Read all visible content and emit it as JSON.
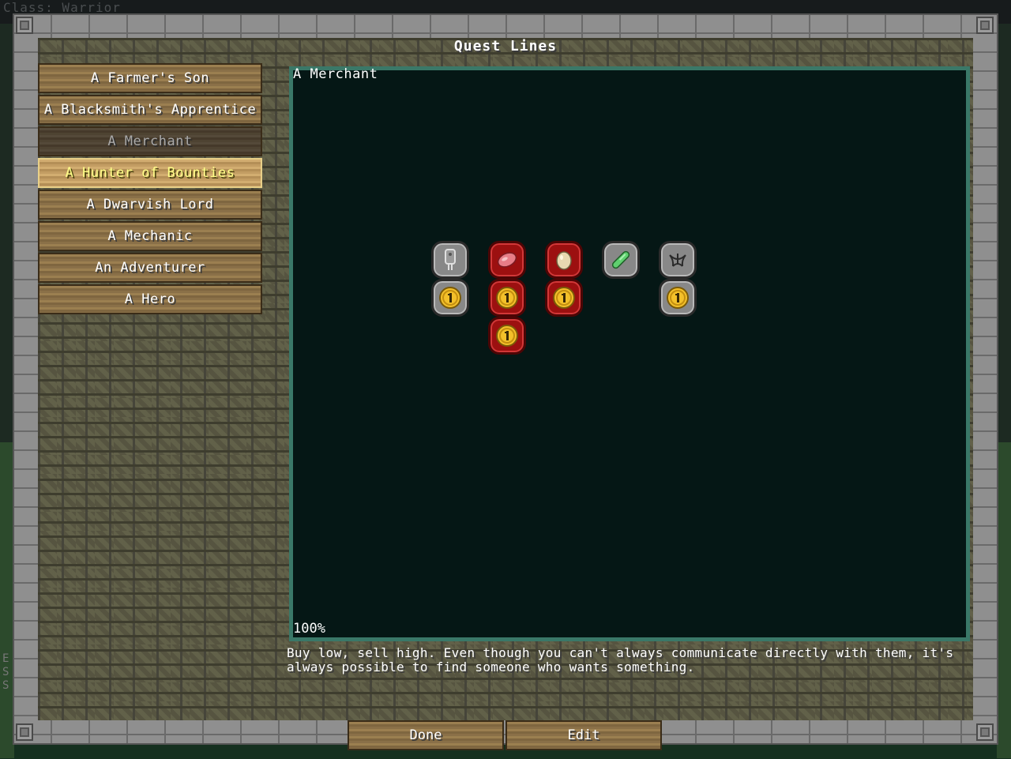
{
  "hud": {
    "class_label": "Class: Warrior",
    "side_letters": "E\nS\nS"
  },
  "window": {
    "title": "Quest Lines"
  },
  "quest_lines": [
    {
      "label": "A Farmer's Son",
      "state": "normal"
    },
    {
      "label": "A Blacksmith's Apprentice",
      "state": "normal"
    },
    {
      "label": "A Merchant",
      "state": "selected"
    },
    {
      "label": "A Hunter of Bounties",
      "state": "hover"
    },
    {
      "label": "A Dwarvish Lord",
      "state": "normal"
    },
    {
      "label": "A Mechanic",
      "state": "normal"
    },
    {
      "label": "An Adventurer",
      "state": "normal"
    },
    {
      "label": "A Hero",
      "state": "normal"
    }
  ],
  "map": {
    "quest_line_name": "A Merchant",
    "zoom": "100%"
  },
  "quests": [
    {
      "icon": "tag-icon",
      "status": "incomplete"
    },
    {
      "icon": "raw-meat-icon",
      "status": "unavailable"
    },
    {
      "icon": "egg-icon",
      "status": "unavailable"
    },
    {
      "icon": "slime-icon",
      "status": "incomplete"
    },
    {
      "icon": "cobweb-icon",
      "status": "incomplete"
    },
    {
      "icon": "gold-coin-icon",
      "status": "incomplete"
    },
    {
      "icon": "gold-coin-icon",
      "status": "unavailable"
    },
    {
      "icon": "gold-coin-icon",
      "status": "unavailable"
    },
    {
      "icon": "gold-coin-icon",
      "status": "incomplete"
    },
    {
      "icon": "gold-coin-icon",
      "status": "unavailable"
    }
  ],
  "description": "Buy low, sell high. Even though you can't always communicate directly with them, it's always possible to find someone who wants something.",
  "buttons": {
    "done": "Done",
    "edit": "Edit"
  },
  "colors": {
    "map_background": "#051715",
    "map_border": "#3a7868",
    "hover_text": "#ffff88",
    "disabled_text": "#a8a8a8",
    "node_incomplete": "#888888",
    "node_unavailable": "#9c1010"
  }
}
